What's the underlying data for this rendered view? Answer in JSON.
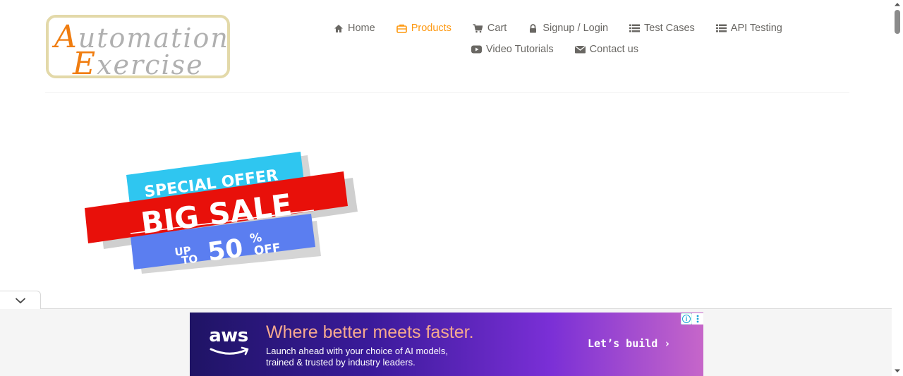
{
  "logo": {
    "line1_cap": "A",
    "line1_rest": "utomation",
    "line2_cap": "E",
    "line2_rest": "xercise"
  },
  "nav": {
    "row1": [
      {
        "label": "Home",
        "icon": "home-icon",
        "active": false
      },
      {
        "label": "Products",
        "icon": "products-icon",
        "active": true
      },
      {
        "label": "Cart",
        "icon": "cart-icon",
        "active": false
      },
      {
        "label": "Signup / Login",
        "icon": "lock-icon",
        "active": false
      },
      {
        "label": "Test Cases",
        "icon": "list-icon",
        "active": false
      },
      {
        "label": "API Testing",
        "icon": "list-icon",
        "active": false
      }
    ],
    "row2": [
      {
        "label": "Video Tutorials",
        "icon": "youtube-play-icon",
        "active": false
      },
      {
        "label": "Contact us",
        "icon": "envelope-icon",
        "active": false
      }
    ]
  },
  "banner": {
    "special_offer": "SPECIAL OFFER",
    "big_sale": "BIG SALE",
    "up": "UP",
    "to": "TO",
    "fifty": "50",
    "percent": "%",
    "off": "OFF"
  },
  "ad": {
    "brand": "aws",
    "headline": "Where better meets faster.",
    "sub_line1": "Launch ahead with your choice of AI models,",
    "sub_line2": "trained & trusted by industry leaders.",
    "cta": "Let’s build ›"
  },
  "colors": {
    "accent": "#fe980f",
    "nav_text": "#696763",
    "banner_cyan": "#2fc6f0",
    "banner_red": "#e8100a",
    "banner_blue": "#5b7ef0"
  }
}
